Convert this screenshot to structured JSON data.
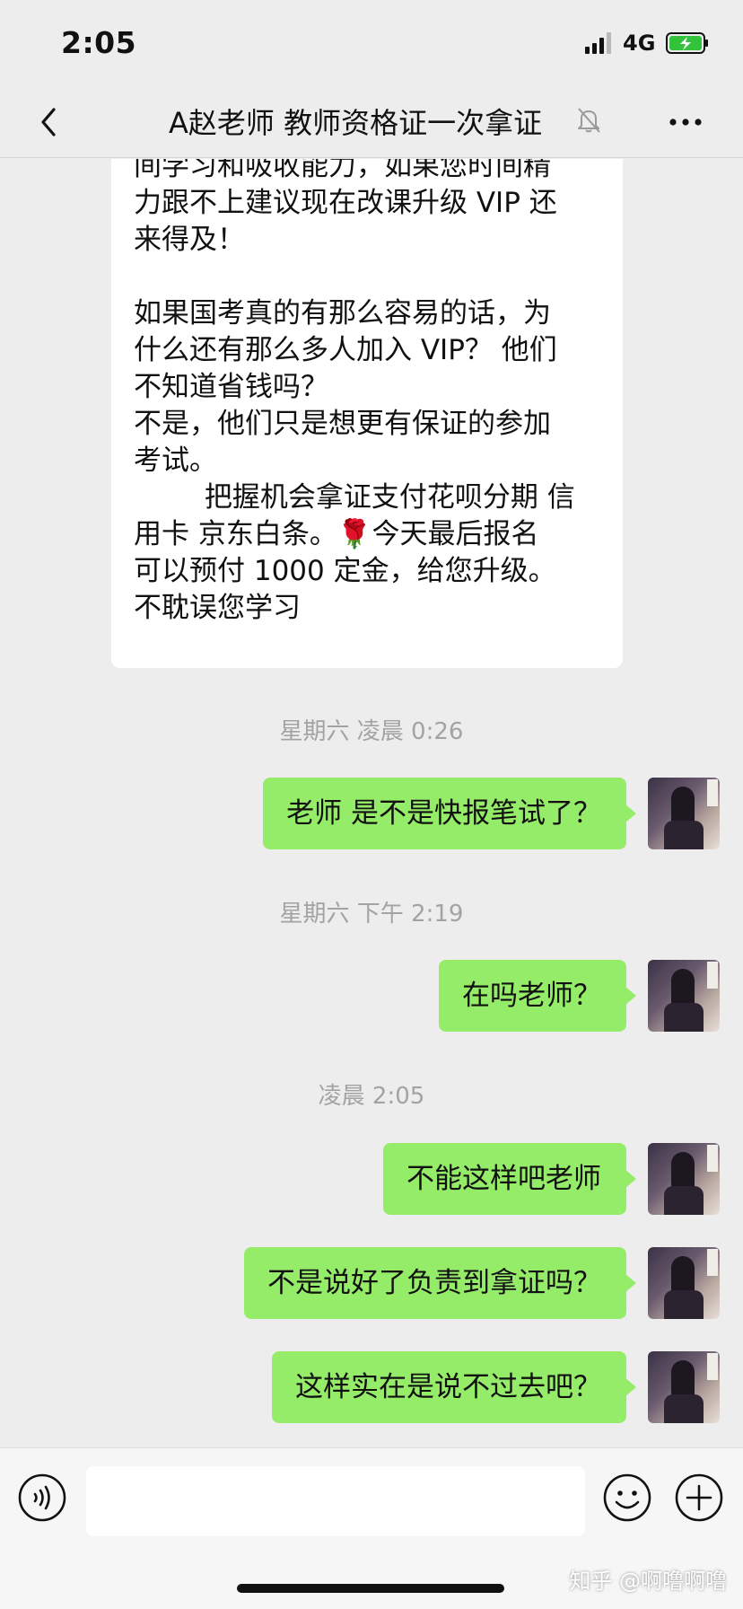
{
  "status_bar": {
    "time": "2:05",
    "network": "4G"
  },
  "header": {
    "title": "A赵老师 教师资格证一次拿证"
  },
  "incoming_message": {
    "paragraph1": [
      "间学习和吸收能力，如果您时间精",
      "力跟不上建议现在改课升级 VIP 还",
      "来得及！"
    ],
    "paragraph2": [
      "如果国考真的有那么容易的话，为",
      "什么还有那么多人加入 VIP？ 他们",
      "不知道省钱吗？",
      "不是，他们只是想更有保证的参加",
      "考试。",
      "        把握机会拿证支付花呗分期 信",
      "用卡 京东白条。🌹今天最后报名",
      "可以预付 1000 定金，给您升级。",
      "不耽误您学习"
    ]
  },
  "messages": [
    {
      "timestamp": "星期六 凌晨 0:26"
    },
    {
      "text": "老师 是不是快报笔试了？"
    },
    {
      "timestamp": "星期六 下午 2:19"
    },
    {
      "text": "在吗老师？"
    },
    {
      "timestamp": "凌晨 2:05"
    },
    {
      "text": "不能这样吧老师"
    },
    {
      "text": "不是说好了负责到拿证吗？"
    },
    {
      "text": "这样实在是说不过去吧？"
    }
  ],
  "input_bar": {
    "placeholder": ""
  },
  "watermark": "知乎 @啊噜啊噜",
  "colors": {
    "background": "#ededed",
    "outgoing_bubble": "#95ec69",
    "incoming_bubble": "#ffffff",
    "timestamp": "#a3a3a3"
  },
  "icons": {
    "back": "chevron-left-icon",
    "mute": "bell-slash-icon",
    "more": "more-dots-icon",
    "voice": "voice-icon",
    "emoji": "emoji-icon",
    "plus": "plus-icon"
  }
}
